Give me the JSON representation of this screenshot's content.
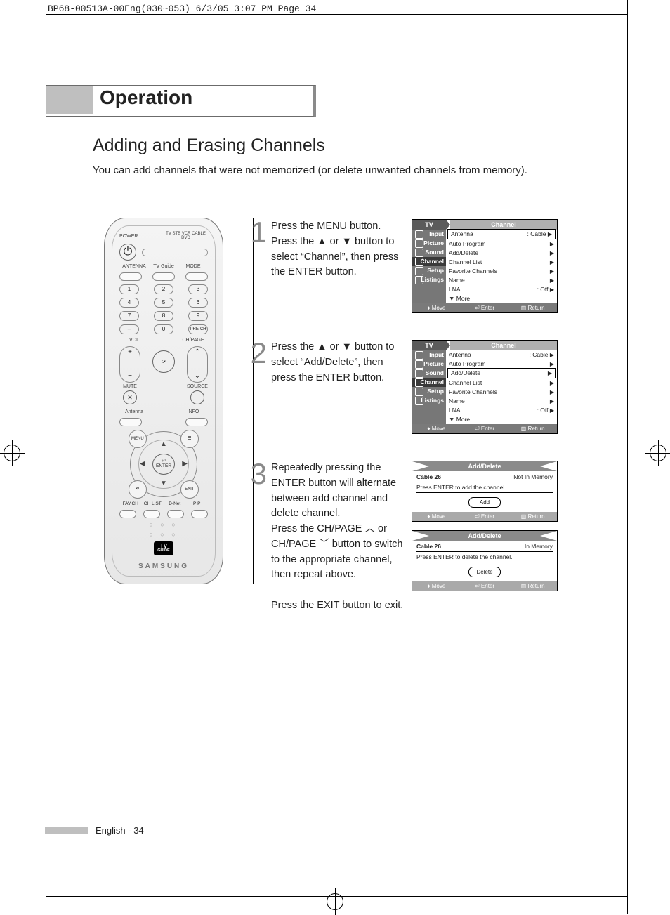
{
  "header_line": "BP68-00513A-00Eng(030~053)  6/3/05  3:07 PM  Page 34",
  "section_title": "Operation",
  "subtitle": "Adding and Erasing Channels",
  "intro": "You can add channels that were not memorized (or delete unwanted channels from memory).",
  "steps": [
    {
      "num": "1",
      "text": "Press the MENU button. Press the ▲ or ▼ button to select “Channel”, then press the ENTER button."
    },
    {
      "num": "2",
      "text": "Press the ▲ or ▼ button to select “Add/Delete”, then press the ENTER button."
    },
    {
      "num": "3",
      "text": "Repeatedly pressing the ENTER button will alternate between add channel and delete channel.\nPress the CH/PAGE ︿ or CH/PAGE ﹀ button to switch to the appropriate channel, then repeat above.\n\nPress the EXIT button to exit."
    }
  ],
  "osd": {
    "tv_label": "TV",
    "title": "Channel",
    "side": [
      "Input",
      "Picture",
      "Sound",
      "Channel",
      "Setup",
      "Listings"
    ],
    "rows": [
      {
        "l": "Antenna",
        "r": ": Cable",
        "a": true
      },
      {
        "l": "Auto Program",
        "r": "",
        "a": true
      },
      {
        "l": "Add/Delete",
        "r": "",
        "a": true
      },
      {
        "l": "Channel List",
        "r": "",
        "a": true
      },
      {
        "l": "Favorite Channels",
        "r": "",
        "a": true
      },
      {
        "l": "Name",
        "r": "",
        "a": true
      },
      {
        "l": "LNA",
        "r": ": Off",
        "a": true
      },
      {
        "l": "▼ More",
        "r": "",
        "a": false
      }
    ],
    "ftr": {
      "move": "Move",
      "enter": "Enter",
      "return": "Return"
    }
  },
  "osd1_sel": 0,
  "osd2_sel": 2,
  "mini_title": "Add/Delete",
  "mini": [
    {
      "ch_l": "Cable   26",
      "ch_r": "Not In Memory",
      "msg": "Press ENTER to add the channel.",
      "btn": "Add"
    },
    {
      "ch_l": "Cable   26",
      "ch_r": "In Memory",
      "msg": "Press ENTER to delete the channel.",
      "btn": "Delete"
    }
  ],
  "mini_ftr": {
    "move": "Move",
    "enter": "Enter",
    "return": "Return"
  },
  "remote": {
    "power": "POWER",
    "mode": "MODE",
    "antenna": "ANTENNA",
    "tvguide": "TV Guide",
    "modes": "TV  STB  VCR  CABLE  DVD",
    "nums": [
      "1",
      "2",
      "3",
      "4",
      "5",
      "6",
      "7",
      "8",
      "9",
      "–",
      "0",
      "PRE-CH"
    ],
    "vol": "VOL",
    "ch": "CH/PAGE",
    "mute": "MUTE",
    "source": "SOURCE",
    "antenna2": "Antenna",
    "info": "INFO",
    "menu": "MENU",
    "exit": "EXIT",
    "enter": "ENTER",
    "bottom4": [
      "FAV.CH",
      "CH LIST",
      "D-Net",
      "PIP"
    ],
    "tvg1": "TV",
    "tvg2": "GUIDE",
    "brand": "SAMSUNG"
  },
  "footer": "English - 34"
}
